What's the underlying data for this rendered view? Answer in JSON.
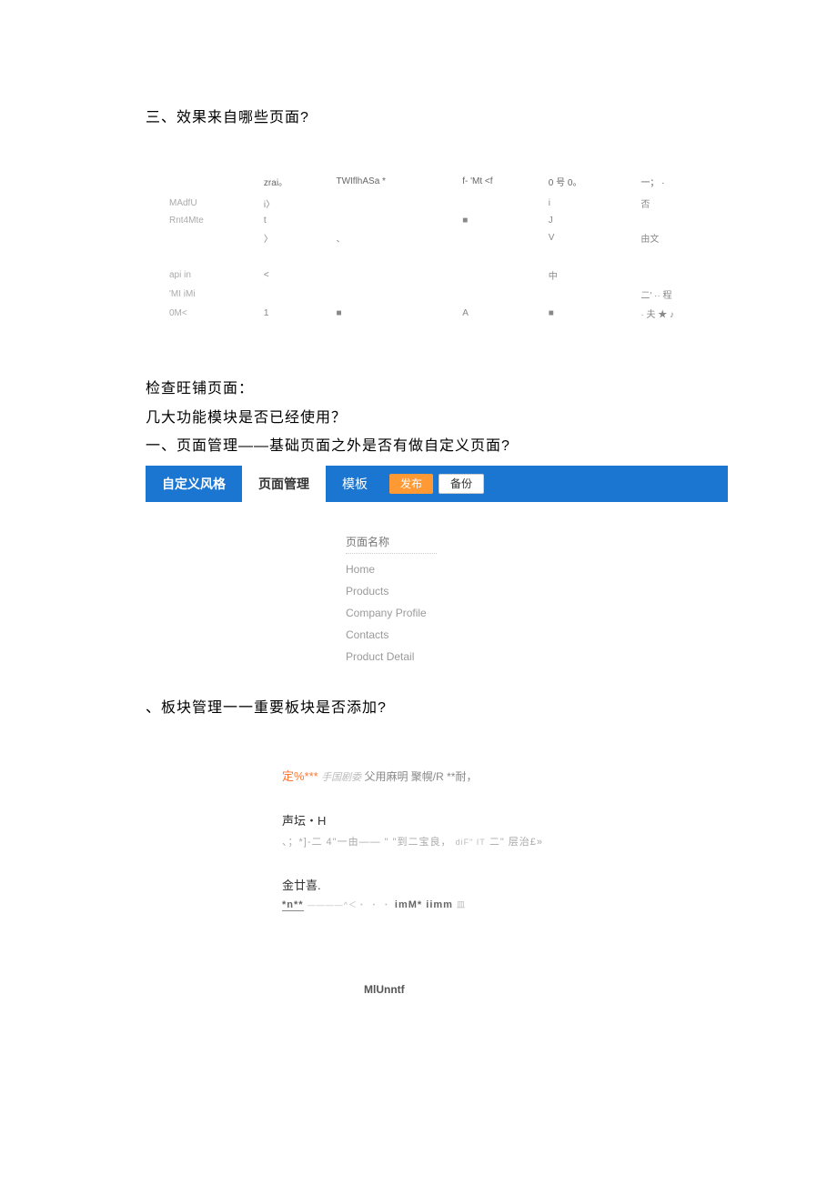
{
  "heading1": "三、效果来自哪些页面?",
  "table": {
    "headers": [
      "",
      "zrai。",
      "TWIflhASa *",
      "f- 'Mt <f",
      "0 号 0。",
      "一；  ·"
    ],
    "rows": [
      [
        "MAdfU",
        "i〉",
        "",
        "",
        "i",
        "否"
      ],
      [
        "Rnt4Mte",
        "t",
        "",
        "■",
        "J",
        ""
      ],
      [
        "",
        "〉",
        "、",
        "",
        "V",
        "由文"
      ],
      [
        "",
        "",
        "",
        "",
        "",
        ""
      ],
      [
        "api in",
        "<",
        "",
        "",
        "中",
        ""
      ],
      [
        "'MI iMi",
        "",
        "",
        "",
        "",
        "二'  ·· 程"
      ],
      [
        "0M<",
        "1",
        "■",
        "A",
        "■",
        "· 夫 ★ ♪"
      ]
    ]
  },
  "paragraphs": {
    "p1": "检查旺铺页面：",
    "p2": "几大功能模块是否已经使用？",
    "p3": "一、页面管理——基础页面之外是否有做自定义页面?"
  },
  "tabs": {
    "style": "自定义风格",
    "page": "页面管理",
    "module": "模板",
    "publish": "发布",
    "backup": "备份"
  },
  "pageList": {
    "header": "页面名称",
    "items": [
      "Home",
      "Products",
      "Company Profile",
      "Contacts",
      "Product Detail"
    ]
  },
  "subHeading": "、板块管理一一重要板块是否添加?",
  "moduleBlock": {
    "line1_orange": "定%***",
    "line1_italic": "手国剧委",
    "line1_rest": " 父用麻明  聚幌/R **耐，",
    "sub1": "声坛・H",
    "garbled1_a": "、；*]-二 4\"一由—— \" \"到二宝良，",
    "garbled1_small": "diF\" IT",
    "garbled1_b": "二\" 层治£»",
    "sub2": "金廿喜.",
    "garbled2_a": "*n**",
    "garbled2_mid": "————^＜・  ・ ・",
    "garbled2_b": "imM* iimm",
    "garbled2_end": "皿",
    "bottom": "MlUnntf"
  }
}
